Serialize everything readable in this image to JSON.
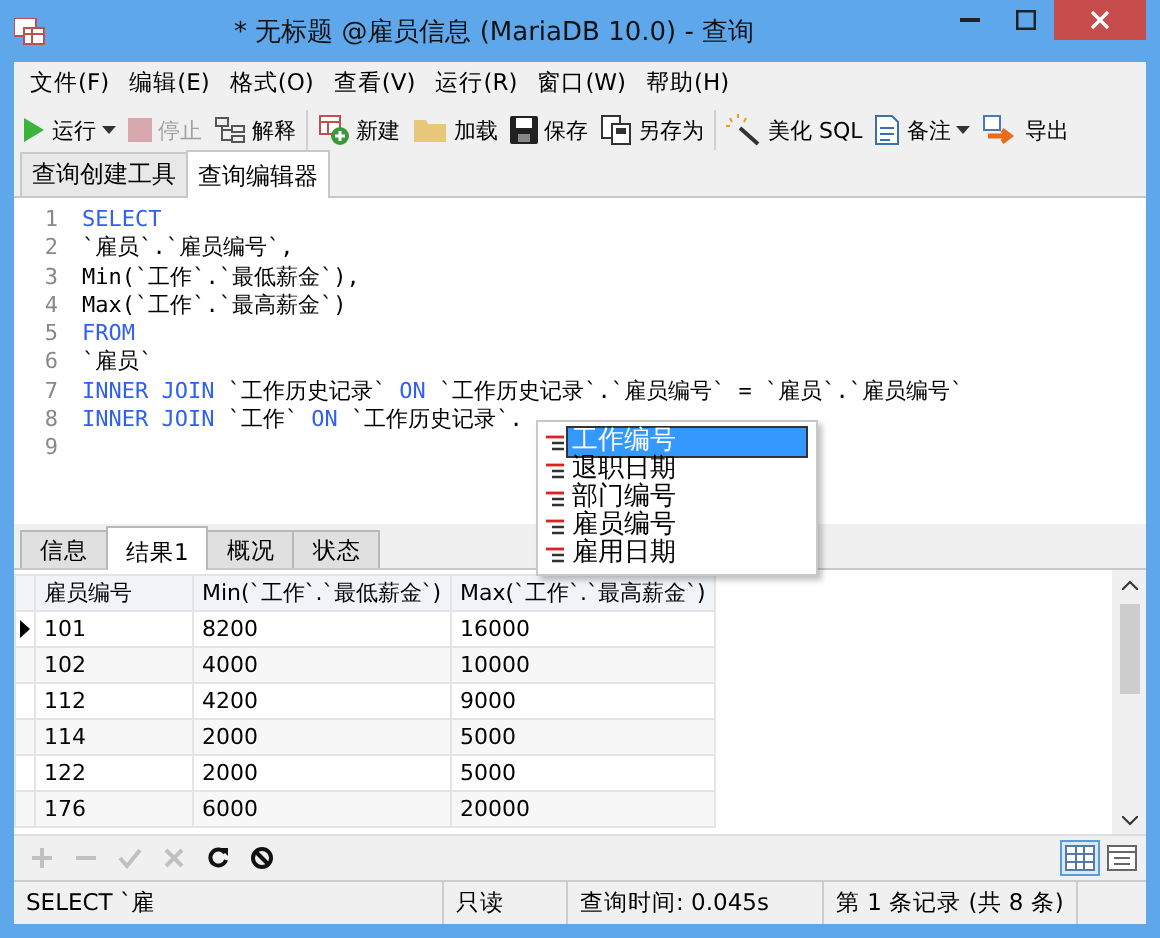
{
  "window": {
    "title": "* 无标题 @雇员信息 (MariaDB 10.0) - 查询"
  },
  "menu": [
    "文件(F)",
    "编辑(E)",
    "格式(O)",
    "查看(V)",
    "运行(R)",
    "窗口(W)",
    "帮助(H)"
  ],
  "toolbar": {
    "groups": [
      [
        {
          "kind": "run",
          "label": "运行",
          "dropdown": true,
          "disabled": false
        },
        {
          "kind": "stop",
          "label": "停止",
          "dropdown": false,
          "disabled": true
        },
        {
          "kind": "explain",
          "label": "解释",
          "dropdown": false,
          "disabled": false
        }
      ],
      [
        {
          "kind": "new",
          "label": "新建",
          "dropdown": false,
          "disabled": false
        },
        {
          "kind": "load",
          "label": "加载",
          "dropdown": false,
          "disabled": false
        },
        {
          "kind": "save",
          "label": "保存",
          "dropdown": false,
          "disabled": false
        },
        {
          "kind": "saveas",
          "label": "另存为",
          "dropdown": false,
          "disabled": false
        }
      ],
      [
        {
          "kind": "beautify",
          "label": "美化 SQL",
          "dropdown": false,
          "disabled": false
        },
        {
          "kind": "note",
          "label": "备注",
          "dropdown": true,
          "disabled": false
        },
        {
          "kind": "export",
          "label": "导出",
          "dropdown": false,
          "disabled": false
        }
      ]
    ]
  },
  "editor_tabs": [
    {
      "label": "查询创建工具",
      "selected": false
    },
    {
      "label": "查询编辑器",
      "selected": true
    }
  ],
  "editor": {
    "lines": [
      {
        "number": "1",
        "segments": [
          {
            "kind": "keyword",
            "text": "SELECT"
          }
        ]
      },
      {
        "number": "2",
        "segments": [
          {
            "kind": "plain",
            "text": "`雇员`.`雇员编号`,"
          }
        ]
      },
      {
        "number": "3",
        "segments": [
          {
            "kind": "plain",
            "text": "Min(`工作`.`最低薪金`),"
          }
        ]
      },
      {
        "number": "4",
        "segments": [
          {
            "kind": "plain",
            "text": "Max(`工作`.`最高薪金`)"
          }
        ]
      },
      {
        "number": "5",
        "segments": [
          {
            "kind": "keyword",
            "text": "FROM"
          }
        ]
      },
      {
        "number": "6",
        "segments": [
          {
            "kind": "plain",
            "text": "`雇员`"
          }
        ]
      },
      {
        "number": "7",
        "segments": [
          {
            "kind": "keyword",
            "text": "INNER JOIN"
          },
          {
            "kind": "plain",
            "text": "`工作历史记录`"
          },
          {
            "kind": "keyword",
            "text": "ON"
          },
          {
            "kind": "plain",
            "text": "`工作历史记录`.`雇员编号` = `雇员`.`雇员编号`"
          }
        ]
      },
      {
        "number": "8",
        "segments": [
          {
            "kind": "keyword",
            "text": "INNER JOIN"
          },
          {
            "kind": "plain",
            "text": "`工作`"
          },
          {
            "kind": "keyword",
            "text": "ON"
          },
          {
            "kind": "plain",
            "text": "`工作历史记录`."
          }
        ]
      },
      {
        "number": "9"
      }
    ]
  },
  "autocomplete": {
    "items": [
      {
        "label": "工作编号",
        "selected": true
      },
      {
        "label": "退职日期",
        "selected": false
      },
      {
        "label": "部门编号",
        "selected": false
      },
      {
        "label": "雇员编号",
        "selected": false
      },
      {
        "label": "雇用日期",
        "selected": false
      }
    ]
  },
  "result_tabs": [
    {
      "label": "信息",
      "selected": false
    },
    {
      "label": "结果1",
      "selected": true
    },
    {
      "label": "概况",
      "selected": false
    },
    {
      "label": "状态",
      "selected": false
    }
  ],
  "table": {
    "columns": [
      "雇员编号",
      "Min(`工作`.`最低薪金`)",
      "Max(`工作`.`最高薪金`)"
    ],
    "rows": [
      {
        "cells": [
          "101",
          "8200",
          "16000"
        ],
        "selected": true
      },
      {
        "cells": [
          "102",
          "4000",
          "10000"
        ],
        "selected": false
      },
      {
        "cells": [
          "112",
          "4200",
          "9000"
        ],
        "selected": false
      },
      {
        "cells": [
          "114",
          "2000",
          "5000"
        ],
        "selected": false
      },
      {
        "cells": [
          "122",
          "2000",
          "5000"
        ],
        "selected": false
      },
      {
        "cells": [
          "176",
          "6000",
          "20000"
        ],
        "selected": false
      }
    ]
  },
  "grid_toolbar": [
    {
      "kind": "add",
      "disabled": true
    },
    {
      "kind": "remove",
      "disabled": true
    },
    {
      "kind": "apply",
      "disabled": true
    },
    {
      "kind": "cancel",
      "disabled": true
    },
    {
      "kind": "refresh",
      "disabled": false
    },
    {
      "kind": "stop",
      "disabled": false
    }
  ],
  "view_buttons": [
    {
      "kind": "grid",
      "selected": true
    },
    {
      "kind": "form",
      "selected": false
    }
  ],
  "status_bar": [
    "SELECT `雇",
    "只读",
    "查询时间: 0.045s",
    "第 1 条记录 (共 8 条)"
  ]
}
